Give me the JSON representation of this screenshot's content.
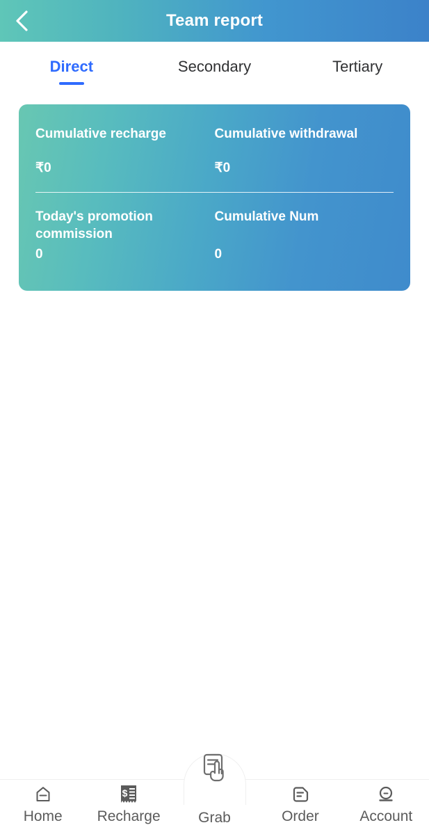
{
  "header": {
    "title": "Team report",
    "back_icon": "chevron-left-icon"
  },
  "tabs": [
    {
      "label": "Direct",
      "active": true
    },
    {
      "label": "Secondary",
      "active": false
    },
    {
      "label": "Tertiary",
      "active": false
    }
  ],
  "card": {
    "top_row": [
      {
        "title": "Cumulative recharge",
        "value": "₹0"
      },
      {
        "title": "Cumulative withdrawal",
        "value": "₹0"
      }
    ],
    "bottom_row": [
      {
        "title": "Today's promotion commission",
        "value": "0"
      },
      {
        "title": "Cumulative Num",
        "value": "0"
      }
    ]
  },
  "bottom_nav": [
    {
      "label": "Home",
      "icon": "home-icon"
    },
    {
      "label": "Recharge",
      "icon": "receipt-dollar-icon"
    },
    {
      "label": "Grab",
      "icon": "document-hand-tap-icon"
    },
    {
      "label": "Order",
      "icon": "document-lines-icon"
    },
    {
      "label": "Account",
      "icon": "user-avatar-icon"
    }
  ],
  "colors": {
    "gradient_start": "#5fc6b8",
    "gradient_end": "#3c82c9",
    "accent_blue": "#2f6bfe",
    "tab_inactive": "#303133",
    "nav_label": "#5b5b5b",
    "card_text": "#ffffff"
  }
}
